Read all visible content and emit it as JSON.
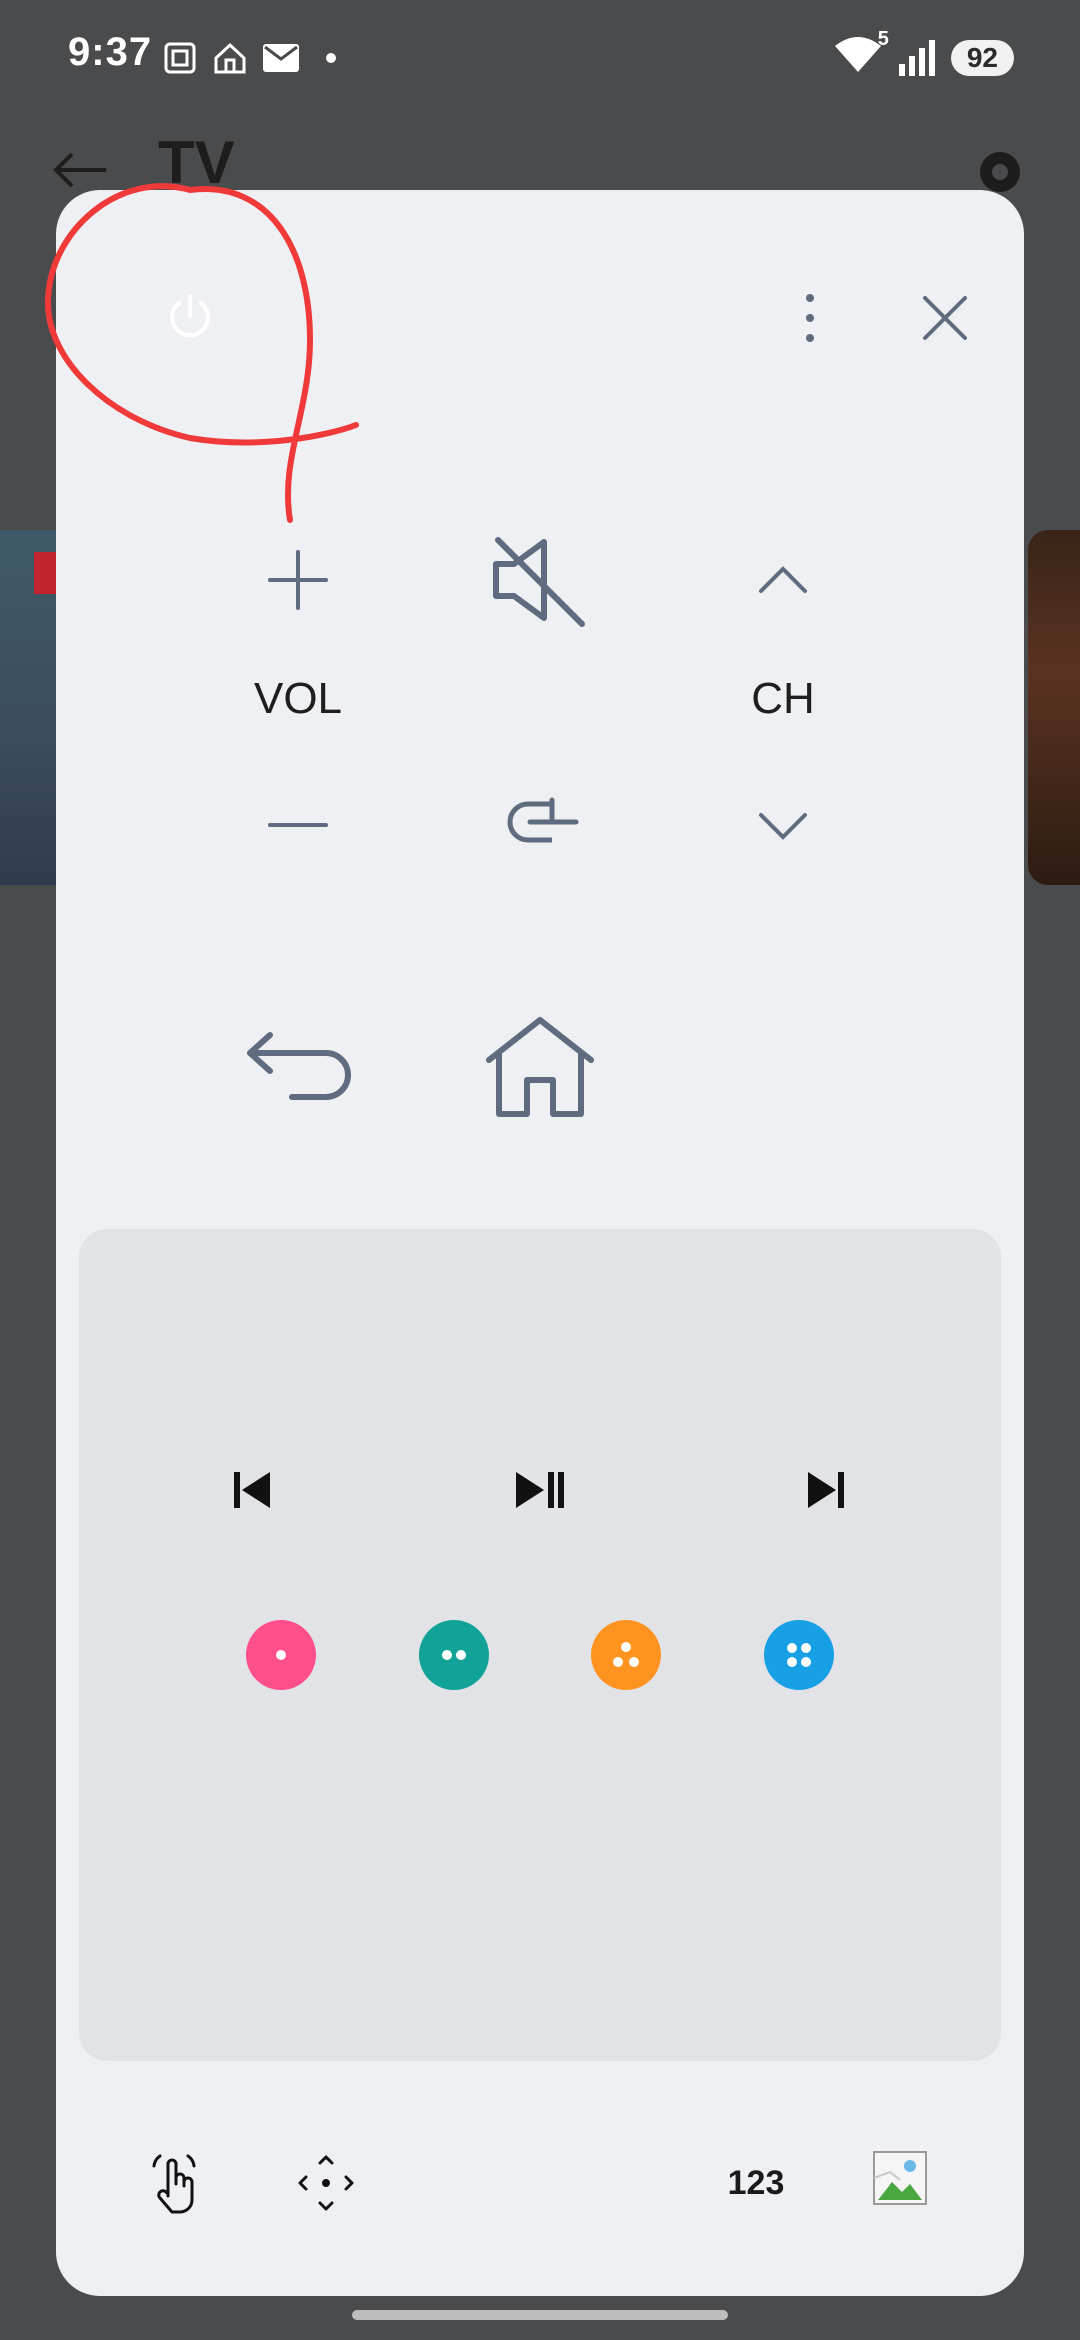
{
  "status_bar": {
    "time": "9:37",
    "battery": "92",
    "network": "5"
  },
  "background_app": {
    "title": "TV"
  },
  "remote": {
    "vol_label": "VOL",
    "ch_label": "CH",
    "numpad_label": "123"
  },
  "colors": {
    "sheet_bg": "#eff0f4",
    "media_panel_bg": "#e2e3e7",
    "icon_gray": "#5f6b7e",
    "red_button": "#ff4f8b",
    "green_button": "#11a397",
    "yellow_button": "#ff9320",
    "blue_button": "#17a0e6",
    "annotation_red": "#f03a3a"
  },
  "icons": {
    "power": "power-icon",
    "more": "more-vertical-icon",
    "close": "close-icon",
    "volume_up": "plus-icon",
    "volume_down": "minus-icon",
    "mute": "mute-icon",
    "input": "input-source-icon",
    "channel_up": "chevron-up-icon",
    "channel_down": "chevron-down-icon",
    "back": "back-arrow-icon",
    "home": "home-icon",
    "previous": "skip-previous-icon",
    "play_pause": "play-pause-icon",
    "next": "skip-next-icon",
    "touch": "touch-icon",
    "dpad": "dpad-icon",
    "broken_image": "broken-image-icon"
  }
}
